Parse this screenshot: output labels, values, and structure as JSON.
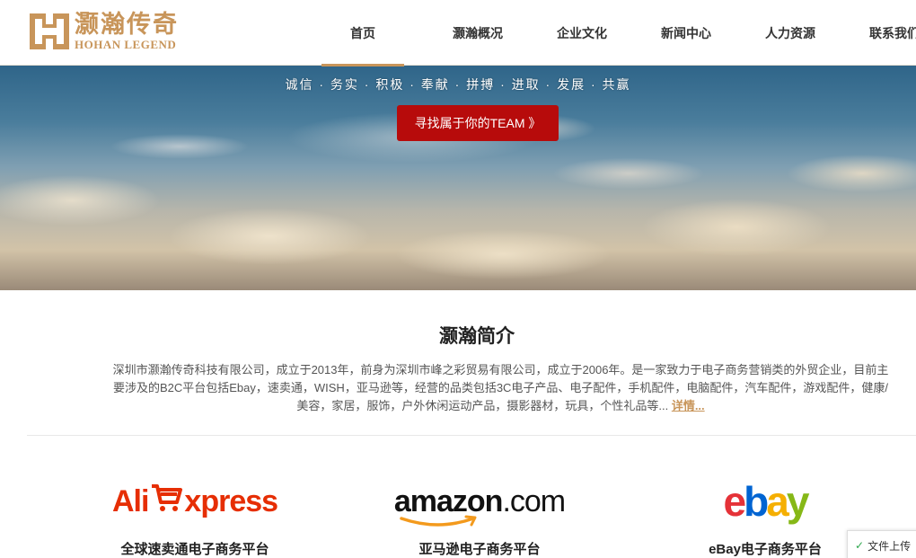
{
  "header": {
    "logo_cn": "灏瀚传奇",
    "logo_en": "HOHAN LEGEND",
    "nav": [
      {
        "label": "首页"
      },
      {
        "label": "灏瀚概况"
      },
      {
        "label": "企业文化"
      },
      {
        "label": "新闻中心"
      },
      {
        "label": "人力资源"
      },
      {
        "label": "联系我们"
      }
    ]
  },
  "hero": {
    "slogan": "诚信 · 务实 · 积极 · 奉献 · 拼搏 · 进取 · 发展 · 共赢",
    "cta_label": "寻找属于你的TEAM 》"
  },
  "intro": {
    "title": "灏瀚简介",
    "body": "深圳市灏瀚传奇科技有限公司，成立于2013年，前身为深圳市峰之彩贸易有限公司，成立于2006年。是一家致力于电子商务营销类的外贸企业，目前主要涉及的B2C平台包括Ebay，速卖通，WISH，亚马逊等，经营的品类包括3C电子产品、电子配件，手机配件，电脑配件，汽车配件，游戏配件，健康/美容，家居，服饰，户外休闲运动产品，摄影器材，玩具，个性礼品等...",
    "more": "详情..."
  },
  "platforms": [
    {
      "logo_a": "Ali",
      "logo_b": "xpress",
      "name": "全球速卖通电子商务平台"
    },
    {
      "logo_a": "amazon",
      "logo_b": ".com",
      "name": "亚马逊电子商务平台"
    },
    {
      "logo_a": "ebay",
      "name": "eBay电子商务平台"
    }
  ],
  "toast": {
    "text": "文件上传"
  },
  "colors": {
    "accent": "#c8955a",
    "cta": "#b70b0b"
  }
}
